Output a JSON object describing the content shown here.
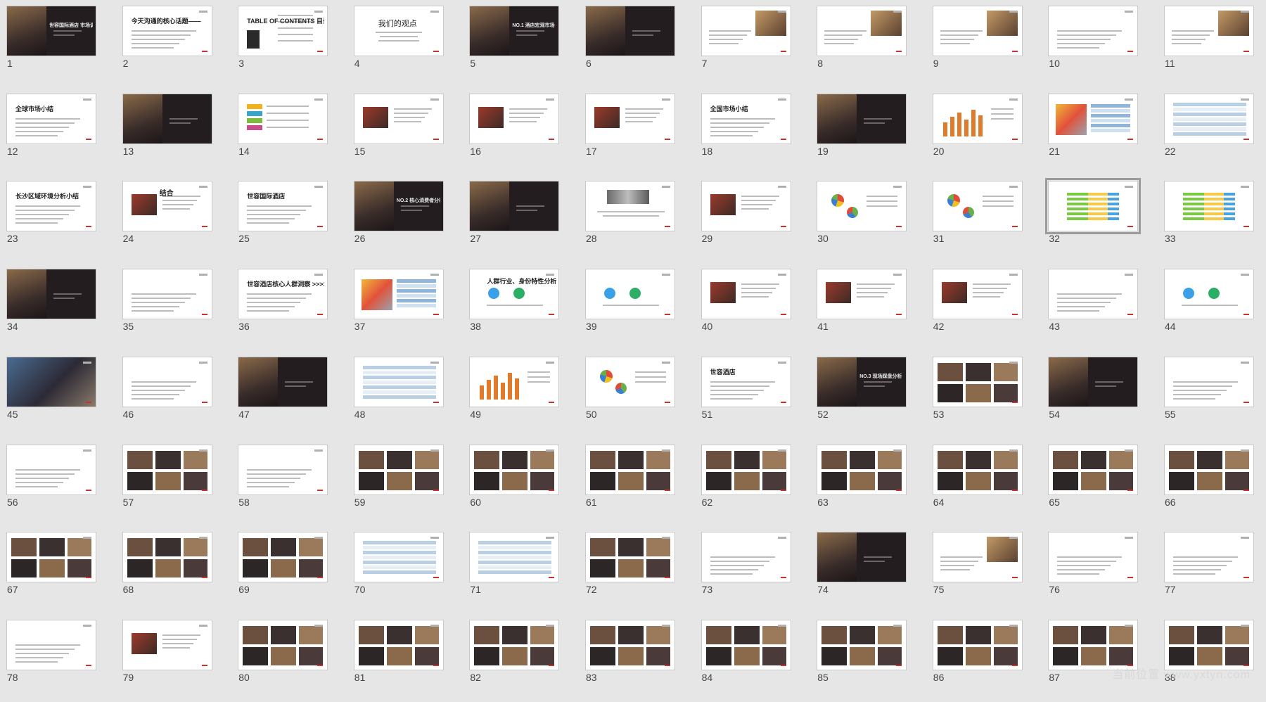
{
  "watermark": "当前位置 www.yxtyn.com",
  "selected_slide": 32,
  "slides": [
    {
      "n": "1",
      "t": "世容国际酒店 市场调研提报方案",
      "k": "dark-photo"
    },
    {
      "n": "2",
      "t": "今天沟通的核心话题——",
      "k": "text"
    },
    {
      "n": "3",
      "t": "TABLE OF CONTENTS 目录",
      "k": "toc"
    },
    {
      "n": "4",
      "t": "我们的观点",
      "k": "text-center"
    },
    {
      "n": "5",
      "t": "NO.1 酒店宏观市场",
      "k": "dark-photo"
    },
    {
      "n": "6",
      "t": "",
      "k": "dark-photo"
    },
    {
      "n": "7",
      "t": "",
      "k": "photo-right"
    },
    {
      "n": "8",
      "t": "",
      "k": "photo-right"
    },
    {
      "n": "9",
      "t": "",
      "k": "photo-right"
    },
    {
      "n": "10",
      "t": "",
      "k": "text"
    },
    {
      "n": "11",
      "t": "",
      "k": "photo-right"
    },
    {
      "n": "12",
      "t": "全球市场小结",
      "k": "text"
    },
    {
      "n": "13",
      "t": "",
      "k": "dark-photo"
    },
    {
      "n": "14",
      "t": "",
      "k": "colorful"
    },
    {
      "n": "15",
      "t": "",
      "k": "photo-left"
    },
    {
      "n": "16",
      "t": "",
      "k": "photo-left"
    },
    {
      "n": "17",
      "t": "",
      "k": "photo-left"
    },
    {
      "n": "18",
      "t": "全国市场小结",
      "k": "text"
    },
    {
      "n": "19",
      "t": "",
      "k": "dark-photo"
    },
    {
      "n": "20",
      "t": "",
      "k": "bars"
    },
    {
      "n": "21",
      "t": "",
      "k": "map-table"
    },
    {
      "n": "22",
      "t": "",
      "k": "table"
    },
    {
      "n": "23",
      "t": "长沙区域环境分析小结",
      "k": "text"
    },
    {
      "n": "24",
      "t": "结合",
      "k": "photo-left"
    },
    {
      "n": "25",
      "t": "世容国际酒店",
      "k": "text"
    },
    {
      "n": "26",
      "t": "NO.2 核心消费者分析",
      "k": "dark-photo"
    },
    {
      "n": "27",
      "t": "",
      "k": "dark-photo"
    },
    {
      "n": "28",
      "t": "",
      "k": "crowd"
    },
    {
      "n": "29",
      "t": "",
      "k": "photo-left"
    },
    {
      "n": "30",
      "t": "",
      "k": "pies"
    },
    {
      "n": "31",
      "t": "",
      "k": "pies"
    },
    {
      "n": "32",
      "t": "",
      "k": "stacked"
    },
    {
      "n": "33",
      "t": "",
      "k": "stacked"
    },
    {
      "n": "34",
      "t": "",
      "k": "dark-photo"
    },
    {
      "n": "35",
      "t": "",
      "k": "text"
    },
    {
      "n": "36",
      "t": "世容酒店核心人群洞察 >>>>",
      "k": "text"
    },
    {
      "n": "37",
      "t": "",
      "k": "map-table"
    },
    {
      "n": "38",
      "t": "人群行业、身份特性分析",
      "k": "circles"
    },
    {
      "n": "39",
      "t": "",
      "k": "circles"
    },
    {
      "n": "40",
      "t": "",
      "k": "photo-left"
    },
    {
      "n": "41",
      "t": "",
      "k": "photo-left"
    },
    {
      "n": "42",
      "t": "",
      "k": "photo-left"
    },
    {
      "n": "43",
      "t": "",
      "k": "text"
    },
    {
      "n": "44",
      "t": "",
      "k": "circles"
    },
    {
      "n": "45",
      "t": "",
      "k": "photo-full"
    },
    {
      "n": "46",
      "t": "",
      "k": "text"
    },
    {
      "n": "47",
      "t": "",
      "k": "dark-photo"
    },
    {
      "n": "48",
      "t": "",
      "k": "table"
    },
    {
      "n": "49",
      "t": "",
      "k": "bars"
    },
    {
      "n": "50",
      "t": "",
      "k": "pies"
    },
    {
      "n": "51",
      "t": "世容酒店",
      "k": "text"
    },
    {
      "n": "52",
      "t": "NO.3 现场踩盘分析",
      "k": "dark-photo"
    },
    {
      "n": "53",
      "t": "",
      "k": "collage"
    },
    {
      "n": "54",
      "t": "",
      "k": "dark-photo"
    },
    {
      "n": "55",
      "t": "",
      "k": "text"
    },
    {
      "n": "56",
      "t": "",
      "k": "text"
    },
    {
      "n": "57",
      "t": "",
      "k": "collage"
    },
    {
      "n": "58",
      "t": "",
      "k": "text"
    },
    {
      "n": "59",
      "t": "",
      "k": "collage"
    },
    {
      "n": "60",
      "t": "",
      "k": "collage"
    },
    {
      "n": "61",
      "t": "",
      "k": "collage"
    },
    {
      "n": "62",
      "t": "",
      "k": "collage"
    },
    {
      "n": "63",
      "t": "",
      "k": "collage"
    },
    {
      "n": "64",
      "t": "",
      "k": "collage"
    },
    {
      "n": "65",
      "t": "",
      "k": "collage"
    },
    {
      "n": "66",
      "t": "",
      "k": "collage"
    },
    {
      "n": "67",
      "t": "",
      "k": "collage"
    },
    {
      "n": "68",
      "t": "",
      "k": "collage"
    },
    {
      "n": "69",
      "t": "",
      "k": "collage"
    },
    {
      "n": "70",
      "t": "",
      "k": "table"
    },
    {
      "n": "71",
      "t": "",
      "k": "table"
    },
    {
      "n": "72",
      "t": "",
      "k": "collage"
    },
    {
      "n": "73",
      "t": "",
      "k": "text"
    },
    {
      "n": "74",
      "t": "",
      "k": "dark-photo"
    },
    {
      "n": "75",
      "t": "",
      "k": "photo-right"
    },
    {
      "n": "76",
      "t": "",
      "k": "text"
    },
    {
      "n": "77",
      "t": "",
      "k": "text"
    },
    {
      "n": "78",
      "t": "",
      "k": "text"
    },
    {
      "n": "79",
      "t": "",
      "k": "photo-left"
    },
    {
      "n": "80",
      "t": "",
      "k": "collage"
    },
    {
      "n": "81",
      "t": "",
      "k": "collage"
    },
    {
      "n": "82",
      "t": "",
      "k": "collage"
    },
    {
      "n": "83",
      "t": "",
      "k": "collage"
    },
    {
      "n": "84",
      "t": "",
      "k": "collage"
    },
    {
      "n": "85",
      "t": "",
      "k": "collage"
    },
    {
      "n": "86",
      "t": "",
      "k": "collage"
    },
    {
      "n": "87",
      "t": "",
      "k": "collage"
    },
    {
      "n": "88",
      "t": "",
      "k": "collage"
    }
  ]
}
